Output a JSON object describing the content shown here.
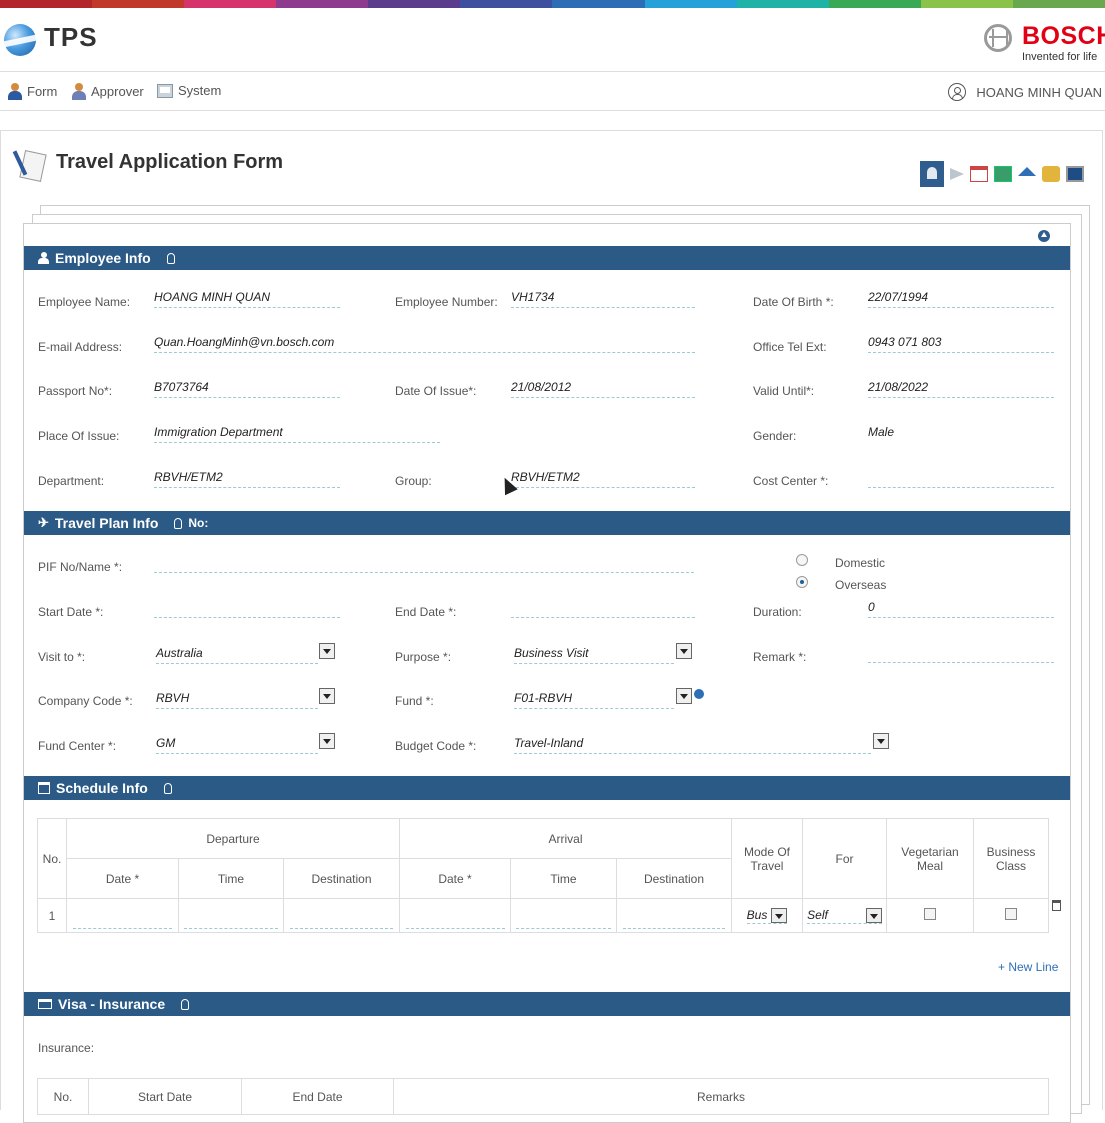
{
  "header": {
    "app_title": "TPS",
    "brand": "BOSCH",
    "tagline": "Invented for life",
    "colorbar": [
      "#b3252a",
      "#c0392b",
      "#d6336c",
      "#8e3a8e",
      "#5b3c8c",
      "#3d4f9e",
      "#2d6db5",
      "#26a0d8",
      "#1fb3a8",
      "#3aa955",
      "#8bc34a",
      "#6aa84f"
    ]
  },
  "nav": {
    "items": [
      {
        "label": "Form",
        "icon": "person-icon"
      },
      {
        "label": "Approver",
        "icon": "approver-icon"
      },
      {
        "label": "System",
        "icon": "system-icon"
      }
    ],
    "user": "HOANG MINH QUAN"
  },
  "page": {
    "title": "Travel Application Form"
  },
  "toolbar": [
    "employee-icon",
    "send-icon",
    "calendar-icon",
    "screen-icon",
    "home-icon",
    "coins-icon",
    "calculator-icon"
  ],
  "employee": {
    "section_title": "Employee Info",
    "name_label": "Employee Name:",
    "name": "HOANG MINH QUAN",
    "number_label": "Employee Number:",
    "number": "VH1734",
    "dob_label": "Date Of Birth *:",
    "dob": "22/07/1994",
    "email_label": "E-mail Address:",
    "email": "Quan.HoangMinh@vn.bosch.com",
    "tel_label": "Office Tel Ext:",
    "tel": "0943 071 803",
    "passport_label": "Passport No*:",
    "passport": "B7073764",
    "issue_label": "Date Of Issue*:",
    "issue": "21/08/2012",
    "valid_label": "Valid Until*:",
    "valid": "21/08/2022",
    "place_label": "Place Of Issue:",
    "place": "Immigration Department",
    "gender_label": "Gender:",
    "gender": "Male",
    "dept_label": "Department:",
    "dept": "RBVH/ETM2",
    "group_label": "Group:",
    "group": "RBVH/ETM2",
    "cost_label": "Cost Center *:",
    "cost": ""
  },
  "travel": {
    "section_title": "Travel Plan Info",
    "no_label": "No:",
    "pif_label": "PIF No/Name *:",
    "domestic": "Domestic",
    "overseas": "Overseas",
    "selected": "Overseas",
    "start_label": "Start Date *:",
    "end_label": "End Date *:",
    "duration_label": "Duration:",
    "duration": "0",
    "visit_label": "Visit to *:",
    "visit": "Australia",
    "purpose_label": "Purpose *:",
    "purpose": "Business Visit",
    "remark_label": "Remark *:",
    "company_label": "Company Code *:",
    "company": "RBVH",
    "fund_label": "Fund *:",
    "fund": "F01-RBVH",
    "fundcenter_label": "Fund Center *:",
    "fundcenter": "GM",
    "budget_label": "Budget Code *:",
    "budget": "Travel-Inland"
  },
  "schedule": {
    "section_title": "Schedule Info",
    "headers": {
      "no": "No.",
      "departure": "Departure",
      "arrival": "Arrival",
      "date": "Date *",
      "time": "Time",
      "destination": "Destination",
      "mode": "Mode Of Travel",
      "for": "For",
      "veg": "Vegetarian Meal",
      "business": "Business Class"
    },
    "rows": [
      {
        "no": "1",
        "mode": "Bus",
        "for": "Self"
      }
    ],
    "new_line": "+ New Line"
  },
  "visa": {
    "section_title": "Visa - Insurance",
    "insurance_label": "Insurance:",
    "headers": {
      "no": "No.",
      "start": "Start Date",
      "end": "End Date",
      "remarks": "Remarks"
    }
  }
}
